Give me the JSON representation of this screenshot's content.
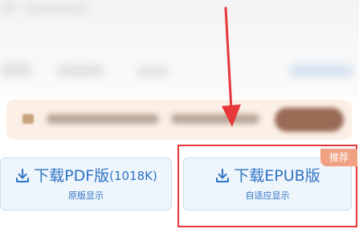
{
  "downloads": {
    "pdf": {
      "label": "下载PDF版",
      "size": "(1018K)",
      "sub": "原版显示"
    },
    "epub": {
      "label": "下载EPUB版",
      "sub": "自适应显示",
      "badge": "推荐"
    }
  },
  "colors": {
    "accent": "#2f73c6",
    "highlight": "#e8373a",
    "badge": "#f0a184",
    "notice_bg": "#fbefe6"
  },
  "icons": {
    "download": "download-icon",
    "pointer_arrow": "red-arrow-annotation"
  }
}
